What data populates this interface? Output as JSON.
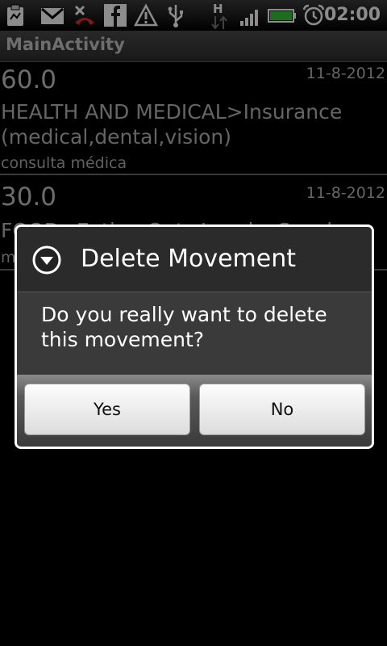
{
  "status_bar": {
    "time": "02:00",
    "icons": [
      "clipboard-icon",
      "gmail-icon",
      "missed-call-icon",
      "facebook-icon",
      "warning-icon",
      "usb-icon",
      "hspa-data-icon",
      "signal-icon",
      "battery-icon",
      "alarm-icon"
    ],
    "data_label": "H"
  },
  "app": {
    "title": "MainActivity"
  },
  "movements": [
    {
      "amount": "60.0",
      "date": "11-8-2012",
      "category": "HEALTH AND MEDICAL>Insurance (medical,dental,vision)",
      "note": "consulta médica"
    },
    {
      "amount": "30.0",
      "date": "11-8-2012",
      "category": "FOOD>Eating Out>Lunch>Snacks",
      "note": "m"
    }
  ],
  "dialog": {
    "title": "Delete Movement",
    "message": "Do you really want to delete this movement?",
    "yes_label": "Yes",
    "no_label": "No"
  },
  "colors": {
    "battery": "#3ac43a",
    "missed_call": "#e03030",
    "background": "#000000"
  }
}
